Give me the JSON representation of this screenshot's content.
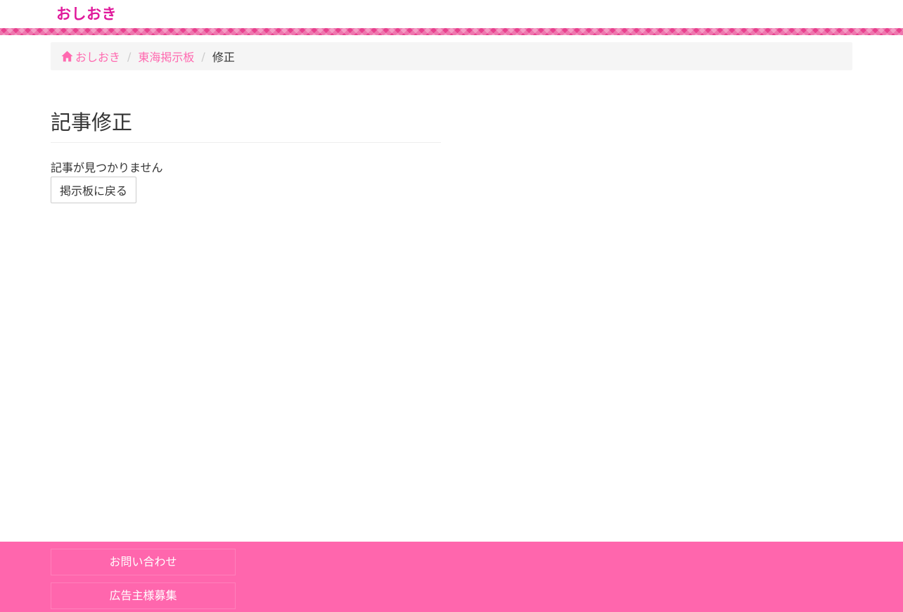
{
  "header": {
    "logo_text": "おしおき",
    "brand_color": "#e0199b",
    "stripe_color": "#e8428f"
  },
  "breadcrumb": {
    "items": [
      {
        "label": "おしおき",
        "icon": "home-icon"
      },
      {
        "label": "東海掲示板"
      },
      {
        "label": "修正"
      }
    ],
    "separator": "/"
  },
  "main": {
    "title": "記事修正",
    "message": "記事が見つかりません",
    "back_button_label": "掲示板に戻る"
  },
  "footer": {
    "background_color": "#ff66ad",
    "links": [
      {
        "label": "お問い合わせ"
      },
      {
        "label": "広告主様募集"
      }
    ]
  }
}
